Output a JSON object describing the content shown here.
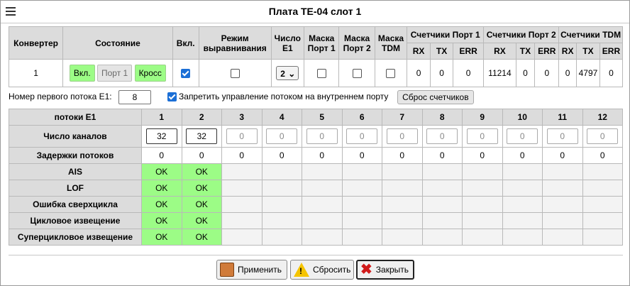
{
  "window": {
    "title": "Плата ТЕ-04 слот 1"
  },
  "top_table": {
    "headers": {
      "converter": "Конвертер",
      "state": "Состояние",
      "enabled": "Вкл.",
      "align_mode": "Режим выравнивания",
      "e1_count": "Число E1",
      "mask_port1": "Маска Порт 1",
      "mask_port2": "Маска Порт 2",
      "mask_tdm": "Маска TDM",
      "counters_port1": "Счетчики Порт 1",
      "counters_port2": "Счетчики Порт 2",
      "counters_tdm": "Счетчики TDM",
      "rx": "RX",
      "tx": "TX",
      "err": "ERR"
    },
    "row": {
      "converter": "1",
      "state_on": "Вкл.",
      "state_port": "Порт 1",
      "state_cross": "Кросс",
      "e1_count": "2",
      "p1_rx": "0",
      "p1_tx": "0",
      "p1_err": "0",
      "p2_rx": "11214",
      "p2_tx": "0",
      "p2_err": "0",
      "tdm_rx": "0",
      "tdm_tx": "4797",
      "tdm_err": "0"
    }
  },
  "options": {
    "first_stream_label": "Номер первого потока E1:",
    "first_stream_value": "8",
    "forbid_label": "Запретить управление потоком на внутреннем порту",
    "reset_counters": "Сброс счетчиков"
  },
  "streams": {
    "header": "потоки E1",
    "columns": [
      "1",
      "2",
      "3",
      "4",
      "5",
      "6",
      "7",
      "8",
      "9",
      "10",
      "11",
      "12"
    ],
    "channels_label": "Число каналов",
    "channels": [
      "32",
      "32",
      "0",
      "0",
      "0",
      "0",
      "0",
      "0",
      "0",
      "0",
      "0",
      "0"
    ],
    "delays_label": "Задержки потоков",
    "delays": [
      "0",
      "0",
      "0",
      "0",
      "0",
      "0",
      "0",
      "0",
      "0",
      "0",
      "0",
      "0"
    ],
    "status_rows": [
      {
        "label": "AIS",
        "values": [
          "OK",
          "OK"
        ]
      },
      {
        "label": "LOF",
        "values": [
          "OK",
          "OK"
        ]
      },
      {
        "label": "Ошибка сверхцикла",
        "values": [
          "OK",
          "OK"
        ]
      },
      {
        "label": "Цикловое извещение",
        "values": [
          "OK",
          "OK"
        ]
      },
      {
        "label": "Суперцикловое извещение",
        "values": [
          "OK",
          "OK"
        ]
      }
    ]
  },
  "footer": {
    "apply": "Применить",
    "reset": "Сбросить",
    "close": "Закрыть"
  }
}
